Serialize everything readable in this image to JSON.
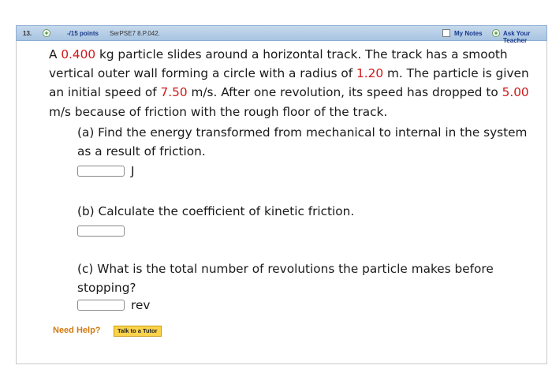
{
  "header": {
    "question_number": "13.",
    "points": "-/15 points",
    "source": "SerPSE7 8.P.042.",
    "my_notes": "My Notes",
    "ask_teacher": "Ask Your Teacher",
    "plus_symbol": "+"
  },
  "problem": {
    "t1": "A ",
    "mass": "0.400",
    "t2": " kg particle slides around a horizontal track. The track has a smooth vertical outer wall forming a circle with a radius of ",
    "radius": "1.20",
    "t3": " m. The particle is given an initial speed of ",
    "initial_speed": "7.50",
    "t4": " m/s. After one revolution, its speed has dropped to ",
    "final_speed": "5.00",
    "t5": " m/s because of friction with the rough floor of the track."
  },
  "parts": [
    {
      "question": "(a) Find the energy transformed from mechanical to internal in the system as a result of friction.",
      "unit": "J",
      "value": ""
    },
    {
      "question": "(b) Calculate the coefficient of kinetic friction.",
      "unit": "",
      "value": ""
    },
    {
      "question": "(c) What is the total number of revolutions the particle makes before stopping?",
      "unit": "rev",
      "value": ""
    }
  ],
  "help": {
    "label": "Need Help?",
    "tutor_button": "Talk to a Tutor"
  },
  "colors": {
    "accent_red": "#d01818",
    "header_blue": "#a8c4e2",
    "help_orange": "#d07a10",
    "tutor_yellow": "#fbd34a"
  }
}
